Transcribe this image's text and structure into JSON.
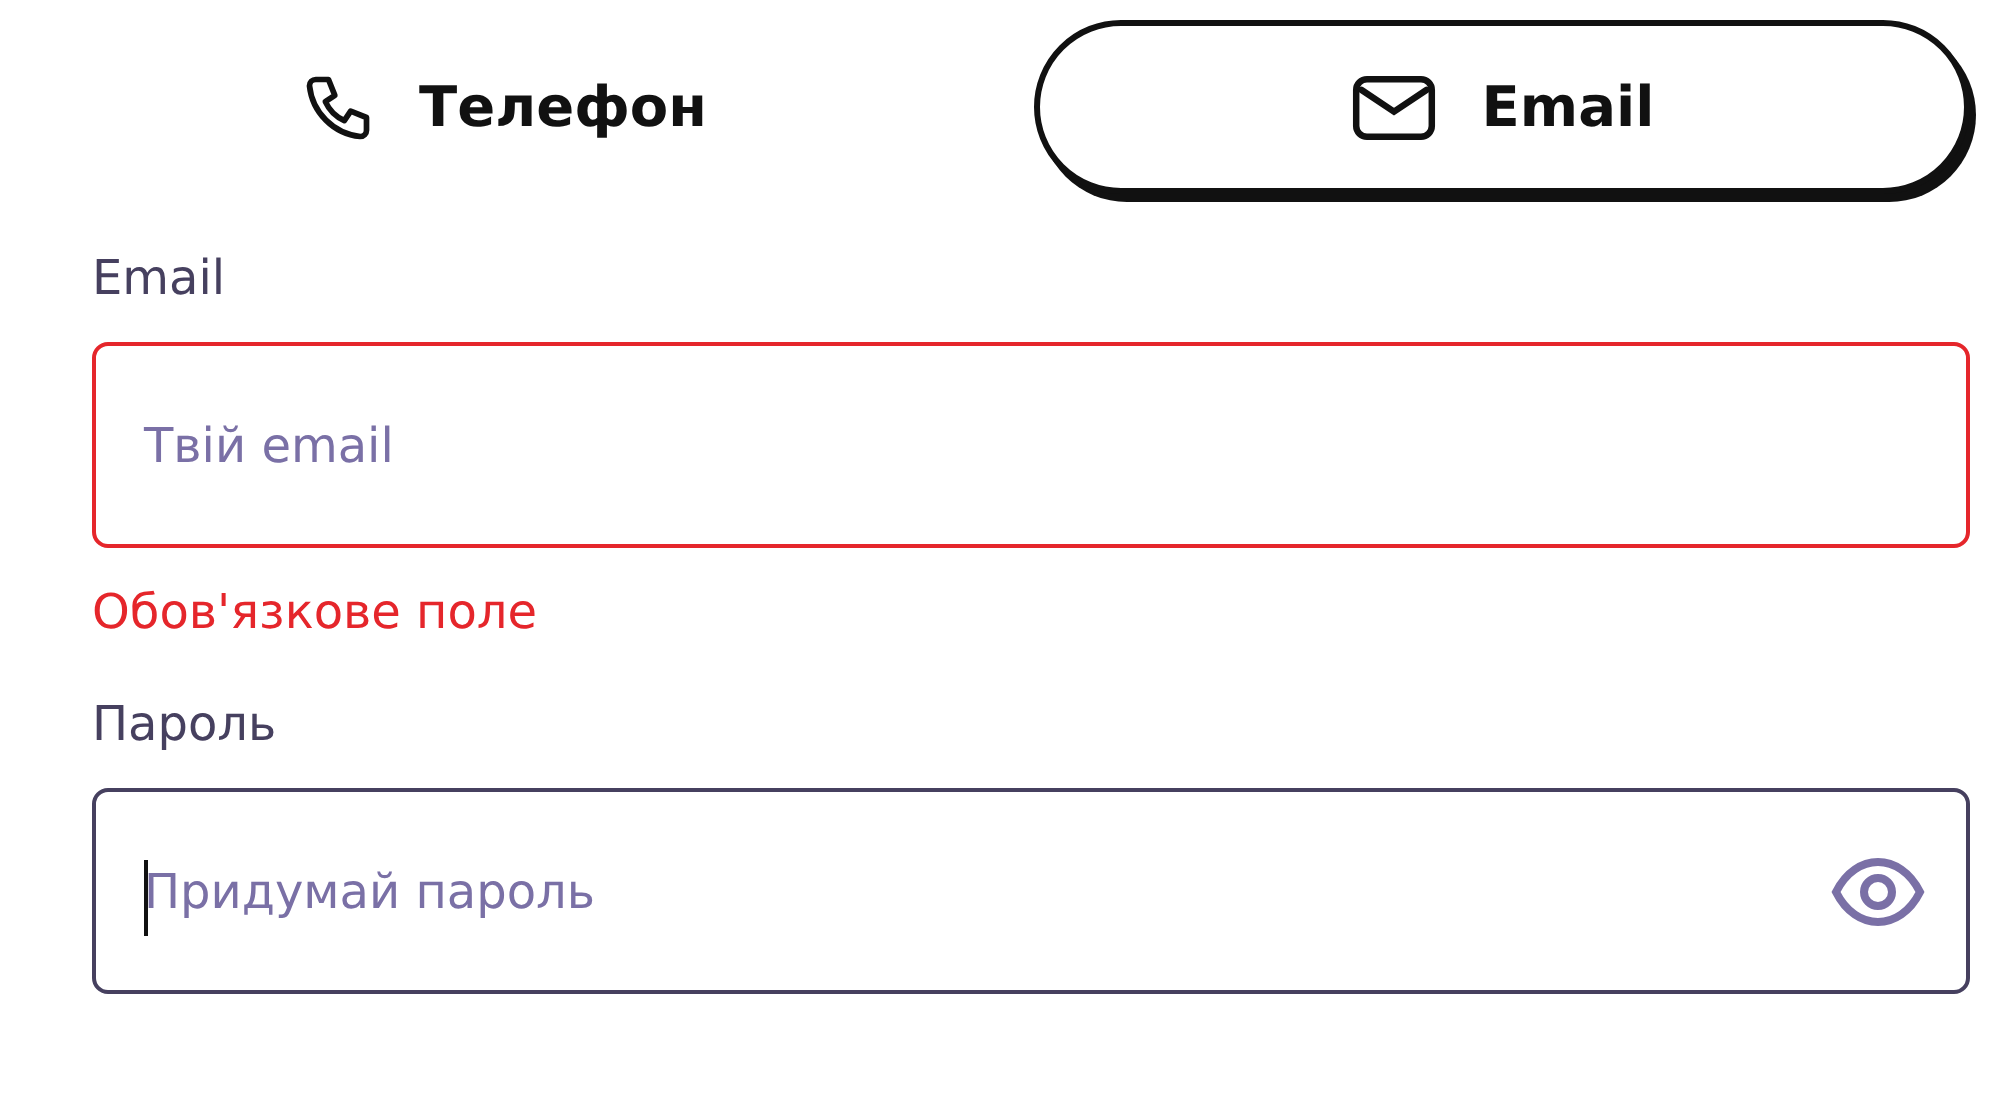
{
  "tabs": [
    {
      "label": "Телефон",
      "kind": "phone",
      "selected": false
    },
    {
      "label": "Email",
      "kind": "mail",
      "selected": true
    }
  ],
  "fields": [
    {
      "kind": "email",
      "label": "Email",
      "placeholder": "Твій email",
      "invalid": true,
      "focused": false,
      "error": "Обов'язкове поле"
    },
    {
      "kind": "password",
      "label": "Пароль",
      "placeholder": "Придумай пароль",
      "invalid": false,
      "focused": true
    }
  ]
}
